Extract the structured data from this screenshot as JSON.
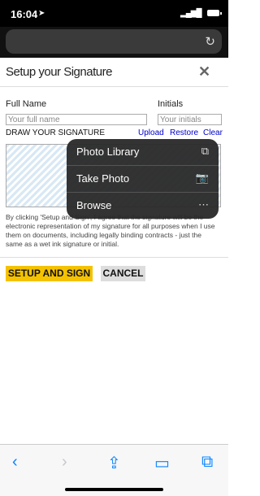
{
  "status_bar": {
    "time": "16:04",
    "icons": [
      "location-arrow-icon",
      "signal-icon",
      "wifi-icon",
      "battery-icon"
    ]
  },
  "browser": {
    "reload_icon": "reload-icon",
    "reload_glyph": "↻"
  },
  "dialog": {
    "title": "Setup your Signature",
    "close_icon": "close-icon",
    "close_glyph": "✕",
    "full_name_label": "Full Name",
    "full_name_placeholder": "Your full name",
    "initials_label": "Initials",
    "initials_placeholder": "Your initials",
    "draw_label": "DRAW YOUR SIGNATURE",
    "links": {
      "upload": "Upload",
      "restore": "Restore",
      "clear": "Clear"
    },
    "consent_text": "By clicking 'Setup and Sign', I agree that the signature will be the electronic representation of my signature for all purposes when I use them on documents, including legally binding contracts - just the same as a wet ink signature or initial.",
    "primary_button": "SETUP AND SIGN",
    "secondary_button": "CANCEL"
  },
  "popup_menu": {
    "items": [
      {
        "label": "Photo Library",
        "icon": "photo-library-icon",
        "glyph": "⧉"
      },
      {
        "label": "Take Photo",
        "icon": "camera-icon",
        "glyph": "📷"
      },
      {
        "label": "Browse",
        "icon": "more-icon",
        "glyph": "⋯"
      }
    ]
  },
  "toolbar": {
    "items": [
      {
        "icon": "back-icon",
        "glyph": "‹",
        "color": "#0a84ff"
      },
      {
        "icon": "forward-icon",
        "glyph": "›",
        "color": "#c7c7cc"
      },
      {
        "icon": "share-icon",
        "glyph": "⇪",
        "color": "#0a84ff"
      },
      {
        "icon": "bookmarks-icon",
        "glyph": "▭",
        "color": "#0a84ff"
      },
      {
        "icon": "tabs-icon",
        "glyph": "⧉",
        "color": "#0a84ff"
      }
    ]
  },
  "colors": {
    "accent": "#f4c200",
    "link": "#0000cc",
    "ios_blue": "#0a84ff"
  }
}
